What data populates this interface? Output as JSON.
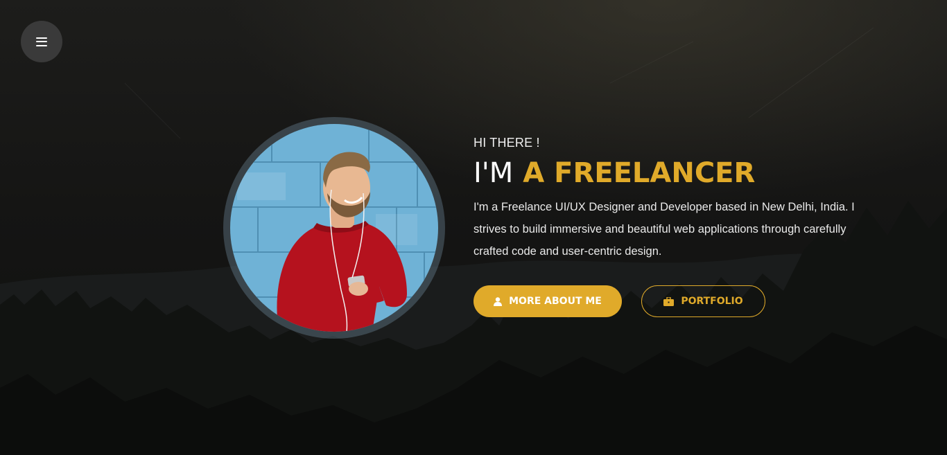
{
  "menu": {
    "icon": "hamburger-menu-icon"
  },
  "hero": {
    "greeting": "HI THERE !",
    "headline_prefix": "I'M",
    "headline_accent": "A FREELANCER",
    "description": "I'm a Freelance UI/UX Designer and Developer based in New Delhi, India. I strives to build immersive and beautiful web applications through carefully crafted code and user-centric design.",
    "primary_button": {
      "label": "MORE ABOUT ME",
      "icon": "user-icon"
    },
    "secondary_button": {
      "label": "PORTFOLIO",
      "icon": "briefcase-icon"
    }
  },
  "colors": {
    "accent": "#e0aa2a",
    "background": "#141414",
    "menu_button": "#3a3a3a"
  }
}
